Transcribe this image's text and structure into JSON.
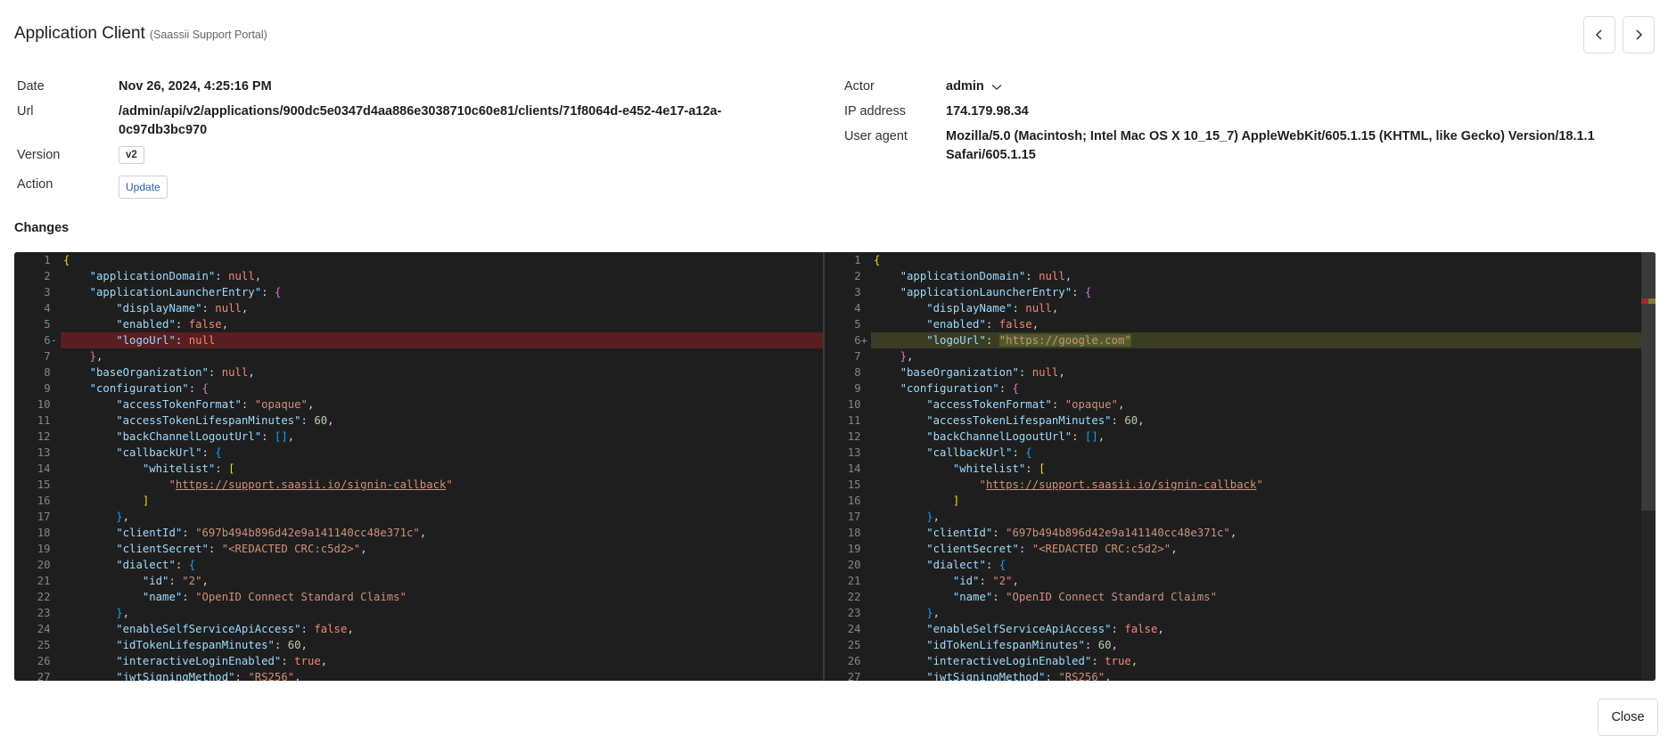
{
  "header": {
    "title": "Application Client",
    "subtitle": "(Saassii Support Portal)"
  },
  "nav": {
    "prev_icon": "chevron-left-icon",
    "next_icon": "chevron-right-icon"
  },
  "details": {
    "date_label": "Date",
    "date_value": "Nov 26, 2024, 4:25:16 PM",
    "url_label": "Url",
    "url_value_line1": "/admin/api/v2/applications/900dc5e0347d4aa886e3038710c60e81/clients/71f8064d-e452-4e17-a12a-",
    "url_value_line2": "0c97db3bc970",
    "version_label": "Version",
    "version_value": "v2",
    "action_label": "Action",
    "action_value": "Update",
    "actor_label": "Actor",
    "actor_value": "admin",
    "ip_label": "IP address",
    "ip_value": "174.179.98.34",
    "ua_label": "User agent",
    "ua_value_line1": "Mozilla/5.0 (Macintosh; Intel Mac OS X 10_15_7) AppleWebKit/605.1.15 (KHTML, like Gecko) Version/18.1.1",
    "ua_value_line2": "Safari/605.1.15"
  },
  "changes": {
    "title": "Changes",
    "left_changed_line": 6,
    "right_changed_line": 6,
    "left_logoUrl": "null",
    "right_logoUrl": "\"https://google.com\""
  },
  "footer": {
    "close_label": "Close"
  },
  "colors": {
    "deleted_bg": "#5a1d22",
    "added_bg": "#3a3d24",
    "editor_bg": "#1e1e1e"
  }
}
